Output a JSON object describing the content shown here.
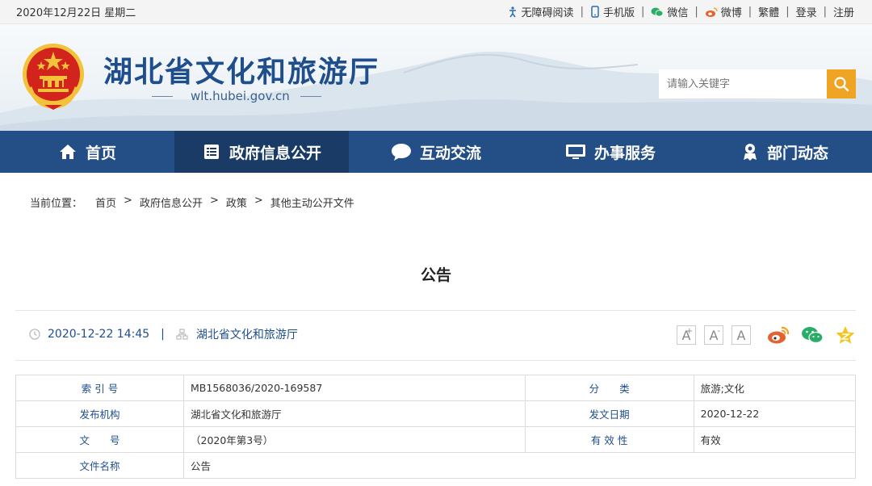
{
  "topbar": {
    "date": "2020年12月22日 星期二",
    "links": [
      {
        "label": "无障碍阅读",
        "icon": "accessibility-icon"
      },
      {
        "label": "手机版",
        "icon": "mobile-icon"
      },
      {
        "label": "微信",
        "icon": "wechat-icon"
      },
      {
        "label": "微博",
        "icon": "weibo-icon"
      },
      {
        "label": "繁體",
        "icon": ""
      },
      {
        "label": "登录",
        "icon": ""
      },
      {
        "label": "注册",
        "icon": ""
      }
    ]
  },
  "header": {
    "site_title": "湖北省文化和旅游厅",
    "site_url": "wlt.hubei.gov.cn",
    "search_placeholder": "请输入关键字"
  },
  "nav": [
    {
      "label": "首页",
      "icon": "home-icon"
    },
    {
      "label": "政府信息公开",
      "icon": "document-list-icon",
      "active": true
    },
    {
      "label": "互动交流",
      "icon": "chat-bubble-icon"
    },
    {
      "label": "办事服务",
      "icon": "monitor-icon"
    },
    {
      "label": "部门动态",
      "icon": "person-badge-icon"
    }
  ],
  "breadcrumb": {
    "prefix": "当前位置：",
    "items": [
      "首页",
      "政府信息公开",
      "政策",
      "其他主动公开文件"
    ],
    "separator": ">"
  },
  "article": {
    "title": "公告",
    "datetime": "2020-12-22 14:45",
    "divider": "|",
    "source": "湖北省文化和旅游厅"
  },
  "font_tools": [
    {
      "label": "A",
      "mark": "+"
    },
    {
      "label": "A",
      "mark": "-"
    },
    {
      "label": "A",
      "mark": ""
    }
  ],
  "info_table": {
    "rows": [
      {
        "k1": "索 引 号",
        "v1": "MB1568036/2020-169587",
        "k2": "分　　类",
        "v2": "旅游;文化"
      },
      {
        "k1": "发布机构",
        "v1": "湖北省文化和旅游厅",
        "k2": "发文日期",
        "v2": "2020-12-22"
      },
      {
        "k1": "文　　号",
        "v1": "（2020年第3号）",
        "k2": "有 效 性",
        "v2": "有效"
      },
      {
        "k1": "文件名称",
        "v1": "公告"
      }
    ]
  },
  "colors": {
    "brand_blue": "#234f86",
    "nav_active": "#193b66",
    "search_button": "#f0a424",
    "link_blue": "#1f4e8c"
  }
}
